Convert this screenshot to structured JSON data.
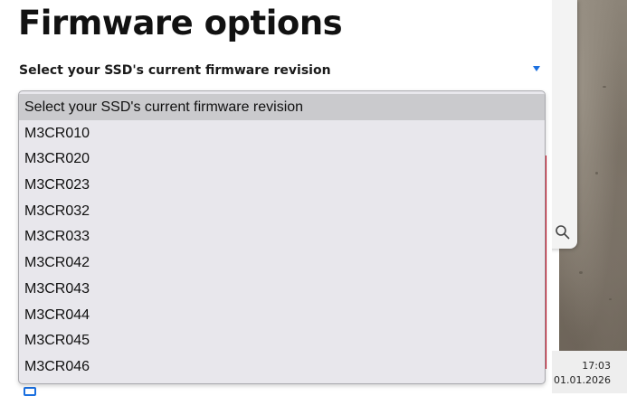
{
  "page": {
    "title": "Firmware options",
    "select_label": "Select your SSD's current firmware revision"
  },
  "dropdown": {
    "options": [
      "Select your SSD's current firmware revision",
      "M3CR010",
      "M3CR020",
      "M3CR023",
      "M3CR032",
      "M3CR033",
      "M3CR042",
      "M3CR043",
      "M3CR044",
      "M3CR045",
      "M3CR046"
    ],
    "selected_index": 0
  },
  "taskbar": {
    "time": "17:03",
    "date": "01.01.2026"
  },
  "colors": {
    "accent": "#1a6fe0",
    "red_accent": "#d0021b"
  }
}
